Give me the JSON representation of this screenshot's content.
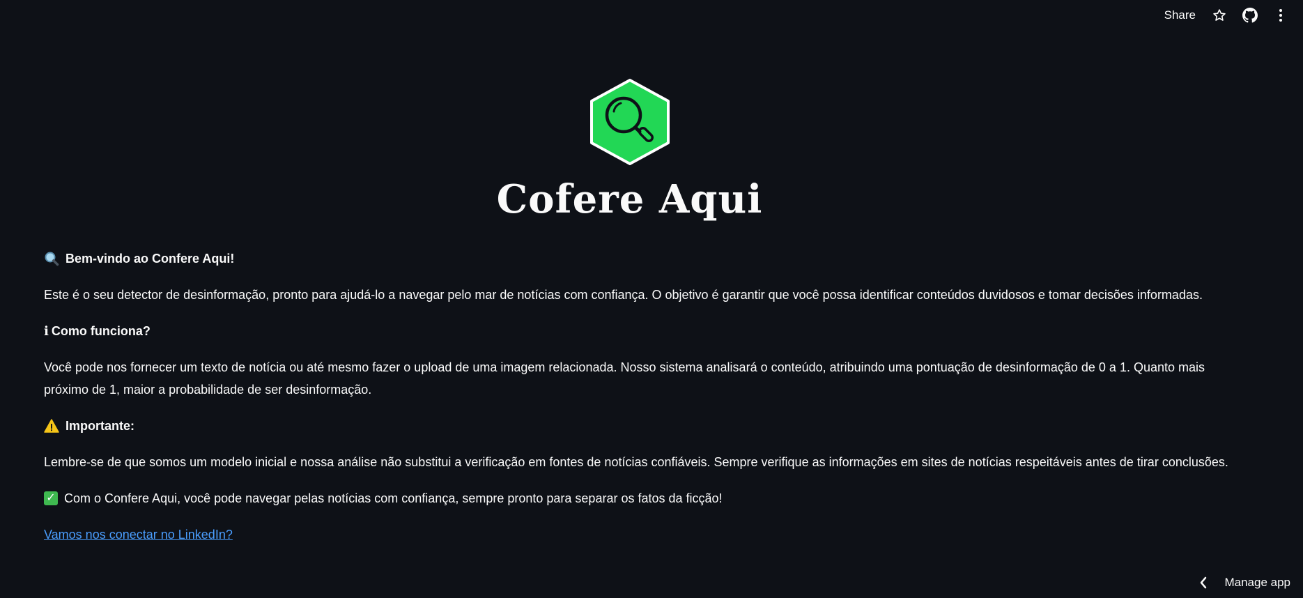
{
  "topbar": {
    "share_label": "Share",
    "icons": [
      "star-icon",
      "github-icon",
      "more-vertical-icon"
    ]
  },
  "logo": {
    "title": "Cofere Aqui",
    "icon": "magnifier-icon",
    "colors": {
      "hex_fill": "#22d755",
      "hex_border": "#ffffff"
    }
  },
  "content": {
    "welcome_icon": "magnifier-icon",
    "welcome": "Bem-vindo ao Confere Aqui!",
    "intro": "Este é o seu detector de desinformação, pronto para ajudá-lo a navegar pelo mar de notícias com confiança. O objetivo é garantir que você possa identificar conteúdos duvidosos e tomar decisões informadas.",
    "how_icon_text": "ℹ",
    "how_heading": "Como funciona?",
    "how_text": "Você pode nos fornecer um texto de notícia ou até mesmo fazer o upload de uma imagem relacionada. Nosso sistema analisará o conteúdo, atribuindo uma pontuação de desinformação de 0 a 1. Quanto mais próximo de 1, maior a probabilidade de ser desinformação.",
    "important_icon": "warning-icon",
    "important_heading": "Importante:",
    "important_text": "Lembre-se de que somos um modelo inicial e nossa análise não substitui a verificação em fontes de notícias confiáveis. Sempre verifique as informações em sites de notícias respeitáveis antes de tirar conclusões.",
    "closing_icon": "check-icon",
    "closing_text": "Com o Confere Aqui, você pode navegar pelas notícias com confiança, sempre pronto para separar os fatos da ficção!",
    "link_text": "Vamos nos conectar no LinkedIn?"
  },
  "footer": {
    "manage_label": "Manage app"
  },
  "colors": {
    "background": "#0e1117",
    "text": "#fafafa",
    "link": "#4a9eff"
  }
}
